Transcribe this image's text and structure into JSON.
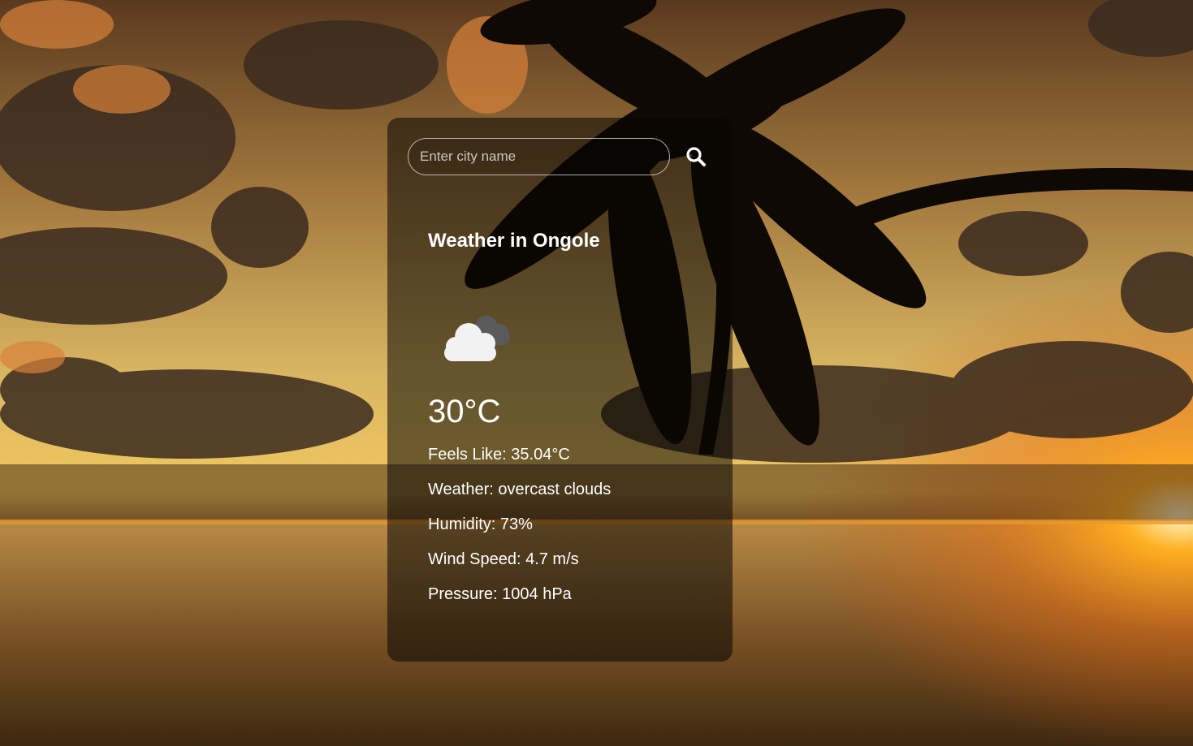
{
  "search": {
    "placeholder": "Enter city name",
    "value": "",
    "icon": "search-icon"
  },
  "weather": {
    "title": "Weather in Ongole",
    "icon": "overcast-clouds-icon",
    "temperature": "30°C",
    "feels_like": "Feels Like: 35.04°C",
    "description": "Weather: overcast clouds",
    "humidity": "Humidity: 73%",
    "wind_speed": "Wind Speed: 4.7 m/s",
    "pressure": "Pressure: 1004 hPa"
  },
  "colors": {
    "text": "#ffffff",
    "card_background": "rgba(8,6,4,0.55)",
    "cloud_front": "#f2f2f2",
    "cloud_back": "#5a5a5a"
  }
}
